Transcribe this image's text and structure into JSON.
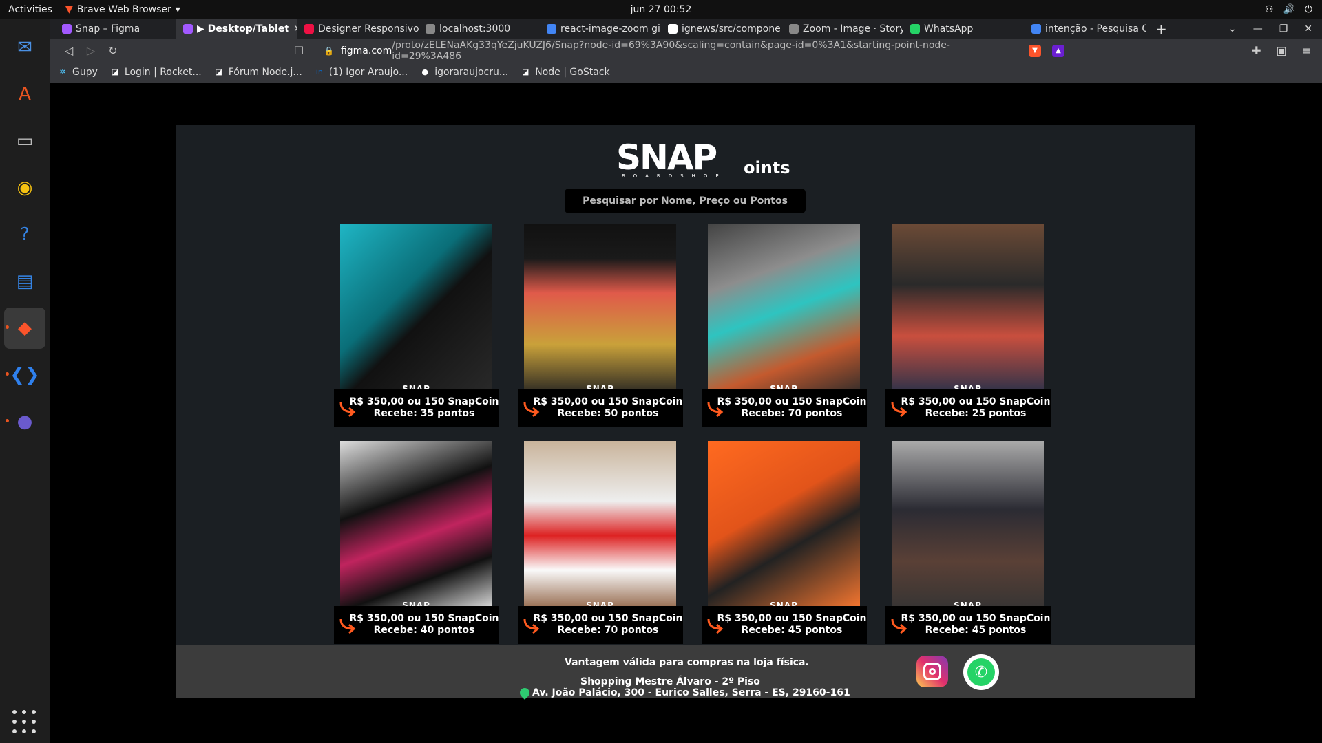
{
  "system": {
    "activities": "Activities",
    "app_name": "Brave Web Browser",
    "clock": "jun 27  00:52"
  },
  "tabs": [
    {
      "title": "Snap – Figma",
      "color": "#a259ff"
    },
    {
      "title": "▶ Desktop/Tablet",
      "color": "#a259ff",
      "active": true
    },
    {
      "title": "Designer Responsivo",
      "color": "#e14"
    },
    {
      "title": "localhost:3000",
      "color": "#888"
    },
    {
      "title": "react-image-zoom gi",
      "color": "#4285f4"
    },
    {
      "title": "ignews/src/compone",
      "color": "#fff"
    },
    {
      "title": "Zoom - Image · Story",
      "color": "#888"
    },
    {
      "title": "WhatsApp",
      "color": "#25d366"
    },
    {
      "title": "intenção - Pesquisa G",
      "color": "#4285f4"
    }
  ],
  "omnibox": {
    "host": "figma.com",
    "path": "/proto/zELENaAKg33qYeZjuKUZJ6/Snap?node-id=69%3A90&scaling=contain&page-id=0%3A1&starting-point-node-id=29%3A486"
  },
  "bookmarks": [
    "Gupy",
    "Login | Rocket...",
    "Fórum Node.j...",
    "(1) Igor Araujo...",
    "igoraraujocru...",
    "Node | GoStack"
  ],
  "page": {
    "logo_main": "SNAP",
    "logo_suffix": "oints",
    "logo_sub": "BOARDSHOP",
    "search_placeholder": "Pesquisar por Nome, Preço ou Pontos",
    "brand_tag": "SNAP"
  },
  "products": [
    {
      "price": "R$ 350,00 ou 150 SnapCoin",
      "points": "Recebe: 35 pontos",
      "image": "g-shock watch black teal"
    },
    {
      "price": "R$ 350,00 ou 150 SnapCoin",
      "points": "Recebe: 50 pontos",
      "image": "graphic t-shirt"
    },
    {
      "price": "R$ 350,00 ou 150 SnapCoin",
      "points": "Recebe: 70 pontos",
      "image": "teal inline skate"
    },
    {
      "price": "R$ 350,00 ou 150 SnapCoin",
      "points": "Recebe: 25 pontos",
      "image": "vans sneakers"
    },
    {
      "price": "R$ 350,00 ou 150 SnapCoin",
      "points": "Recebe: 40 pontos",
      "image": "vans checkered sneaker"
    },
    {
      "price": "R$ 350,00 ou 150 SnapCoin",
      "points": "Recebe: 70 pontos",
      "image": "man holding sneakers"
    },
    {
      "price": "R$ 350,00 ou 150 SnapCoin",
      "points": "Recebe: 45 pontos",
      "image": "orange g-shock watch"
    },
    {
      "price": "R$ 350,00 ou 150 SnapCoin",
      "points": "Recebe: 45 pontos",
      "image": "man with sunglasses hoodie"
    }
  ],
  "footer": {
    "line1": "Vantagem válida para compras na loja física.",
    "line2": "Shopping Mestre Álvaro - 2º Piso",
    "line3": "Av. João Palácio, 300 - Eurico Salles, Serra - ES, 29160-161"
  },
  "colors": {
    "accent_arrow": "#ff5a1f",
    "frame_bg": "#1b1f23",
    "footer_bg": "#3c3c3c"
  }
}
